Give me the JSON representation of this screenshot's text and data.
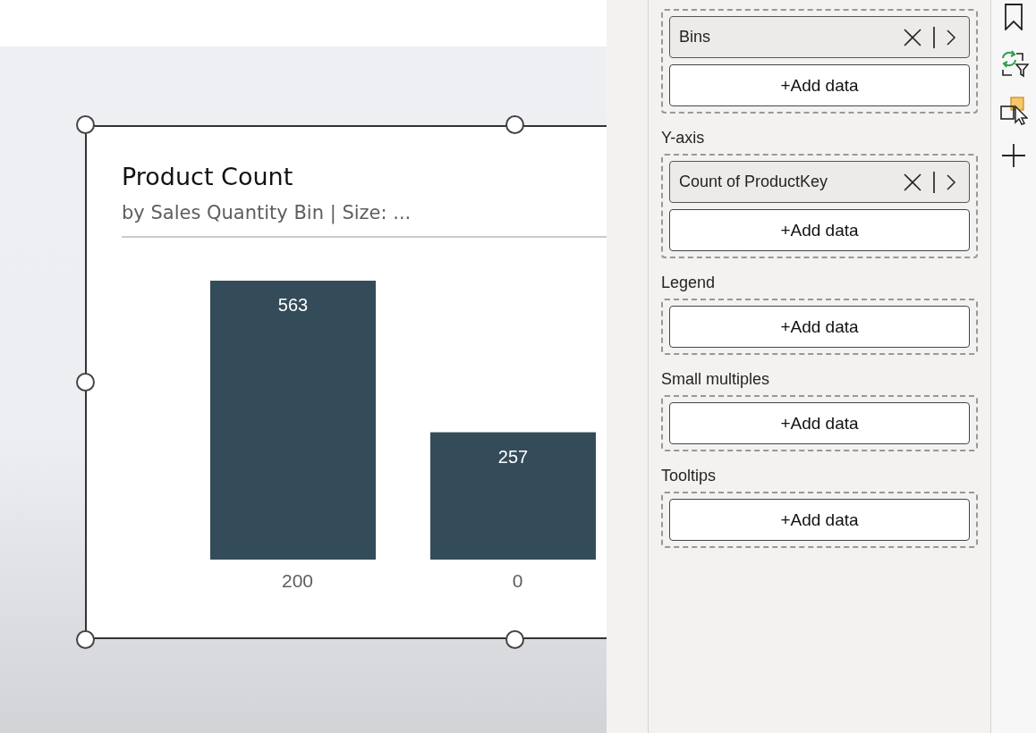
{
  "visual": {
    "title": "Product Count",
    "subtitle": "by Sales Quantity Bin | Size: ...",
    "chart_data": {
      "type": "bar",
      "categories": [
        "200",
        "0"
      ],
      "values": [
        563,
        257
      ],
      "data_labels": true
    }
  },
  "fields_pane": {
    "wells": [
      {
        "fields": [
          {
            "name": "Bins"
          }
        ],
        "add_button": "+Add data"
      },
      {
        "title": "Y-axis",
        "fields": [
          {
            "name": "Count of ProductKey"
          }
        ],
        "add_button": "+Add data"
      },
      {
        "title": "Legend",
        "add_button": "+Add data"
      },
      {
        "title": "Small multiples",
        "add_button": "+Add data"
      },
      {
        "title": "Tooltips",
        "add_button": "+Add data"
      }
    ]
  },
  "right_rail": {
    "icons": [
      {
        "kind": "bookmark"
      },
      {
        "kind": "sync-filter"
      },
      {
        "kind": "selection"
      },
      {
        "kind": "add"
      }
    ]
  }
}
